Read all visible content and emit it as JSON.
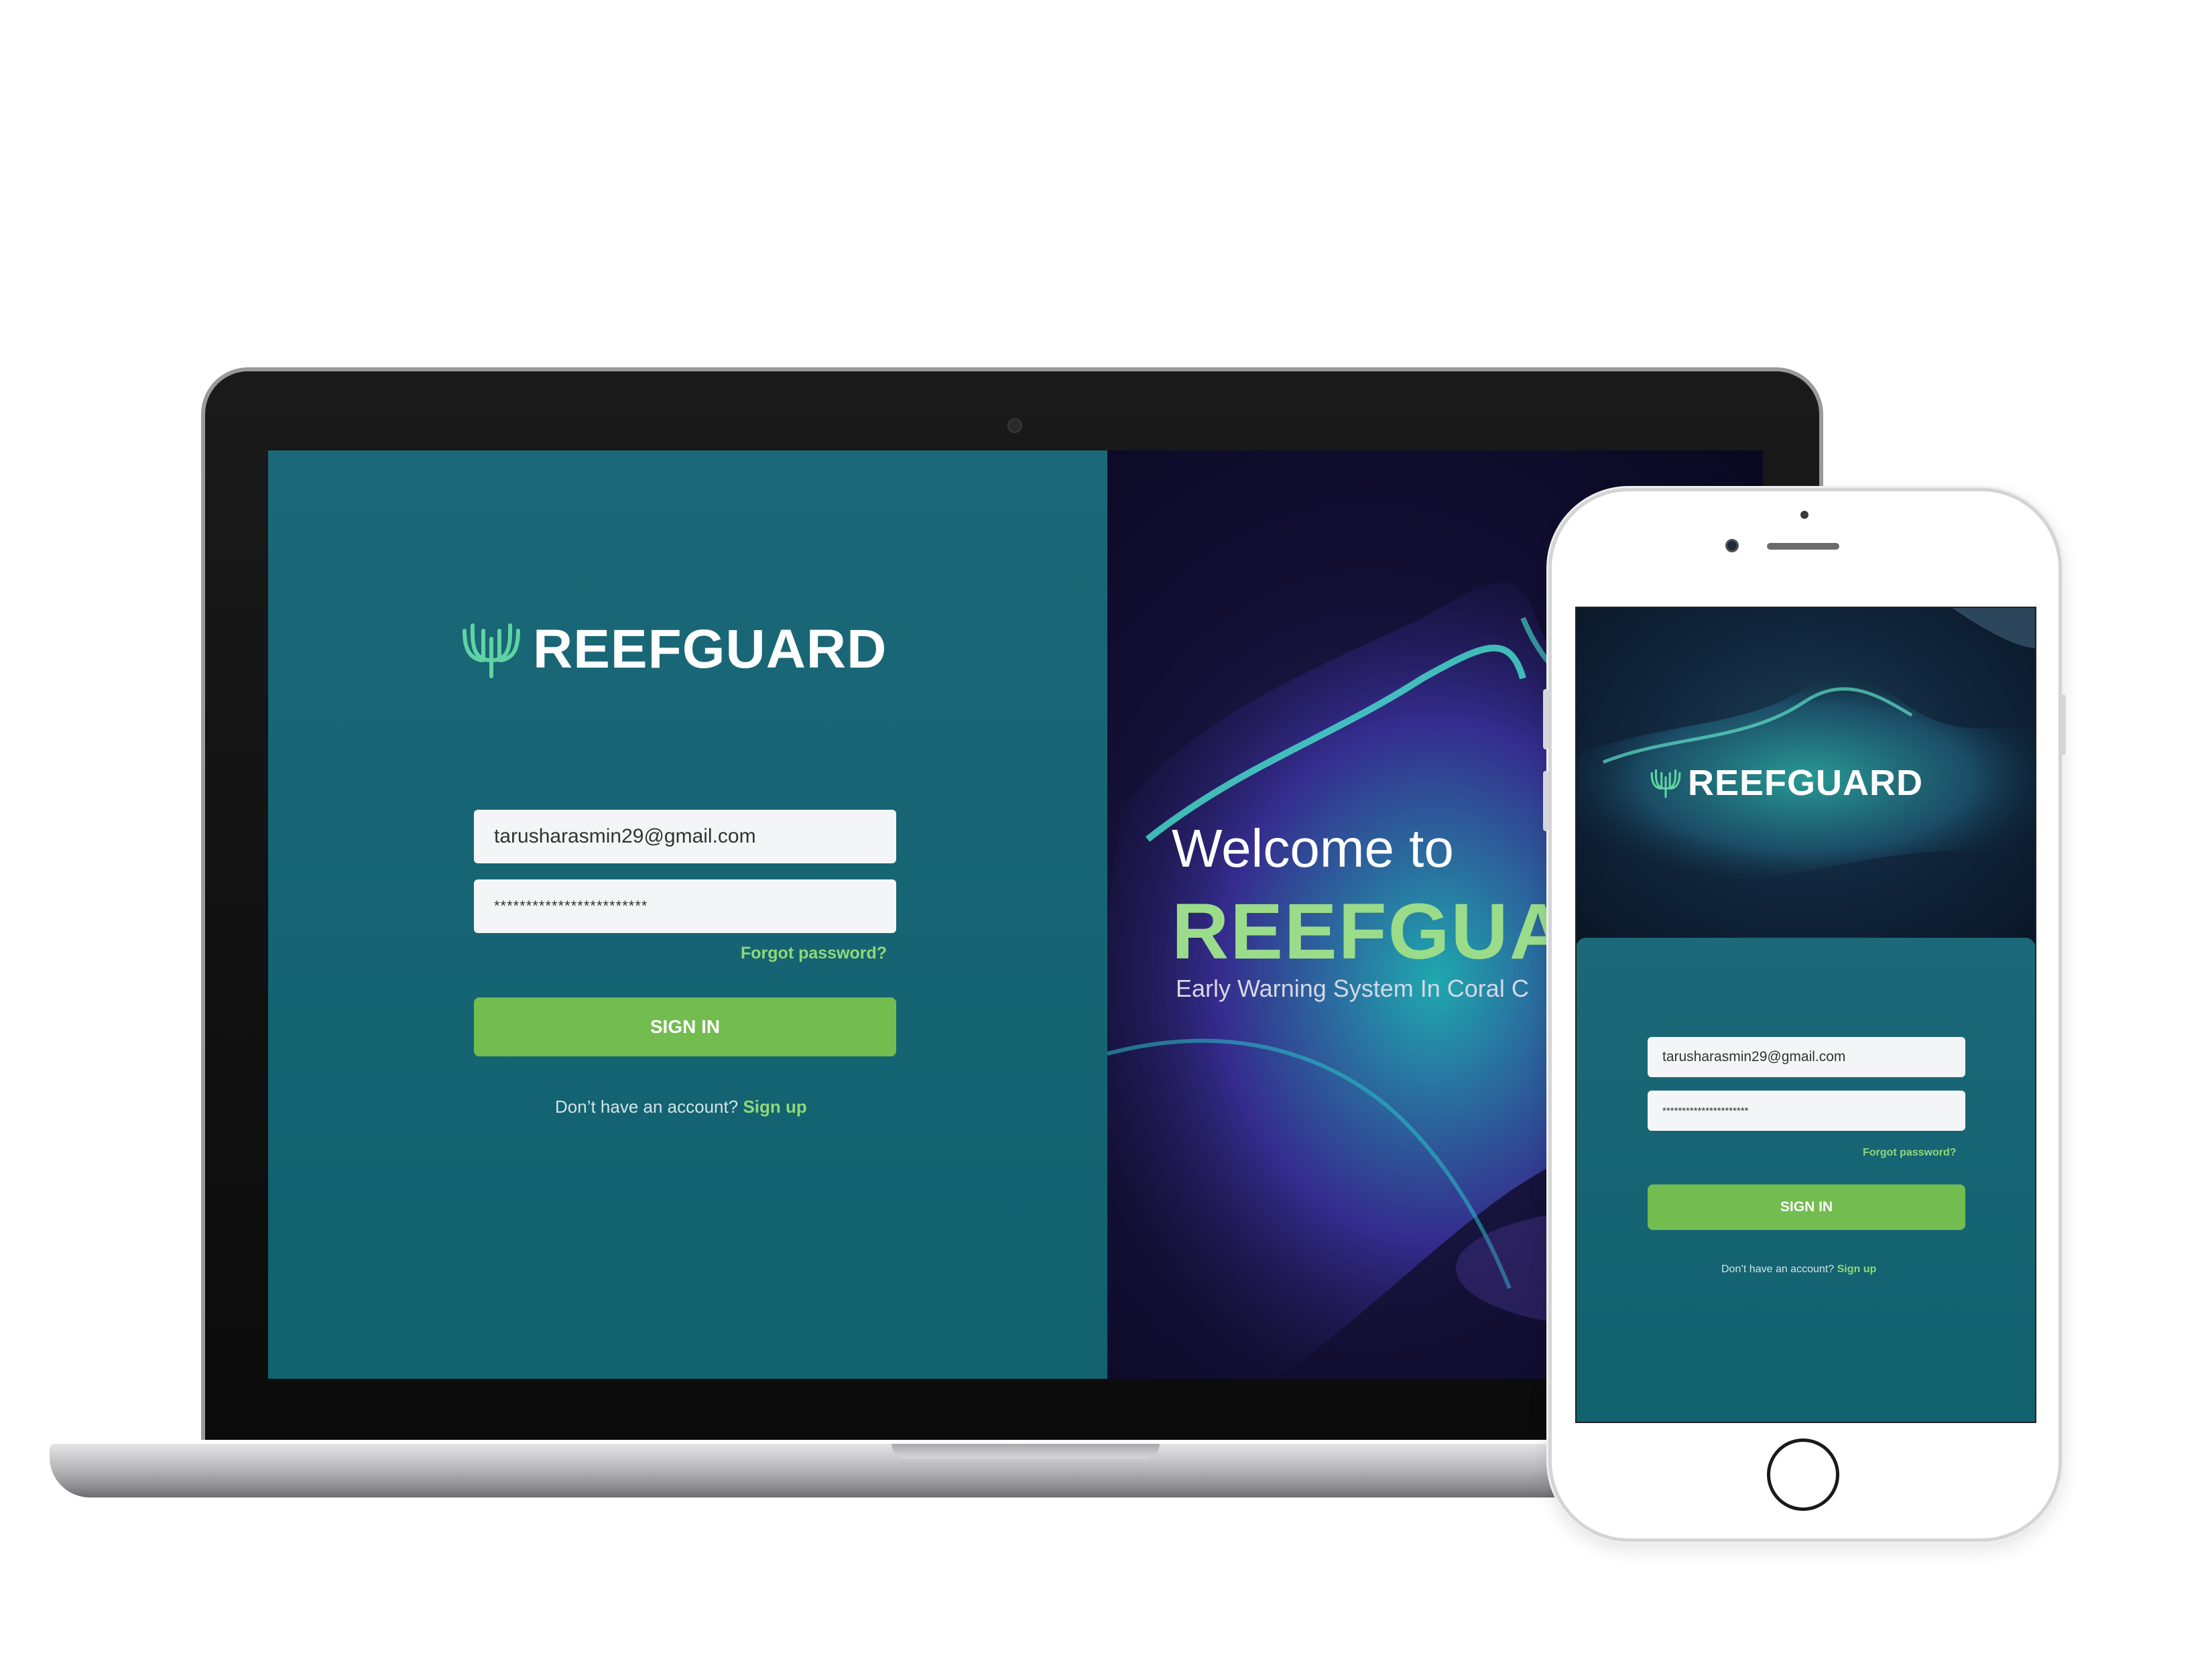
{
  "brand": {
    "name": "REEFGUARD",
    "logo_icon": "coral-logo-icon",
    "accent_color": "#5fd3a3"
  },
  "laptop": {
    "login": {
      "email_value": "tarusharasmin29@gmail.com",
      "password_value": "************************",
      "forgot_label": "Forgot password?",
      "signin_label": "SIGN IN",
      "signup_prompt": "Don’t have an account?",
      "signup_link": "Sign up"
    },
    "hero": {
      "welcome": "Welcome to",
      "title": "REEFGUA",
      "tagline": "Early Warning System In Coral C"
    }
  },
  "phone": {
    "login": {
      "email_value": "tarusharasmin29@gmail.com",
      "password_value": "**********************",
      "forgot_label": "Forgot password?",
      "signin_label": "SIGN IN",
      "signup_prompt": "Don’t have an account?",
      "signup_link": "Sign up"
    }
  },
  "colors": {
    "panel_teal": "#1b6878",
    "button_green": "#72bc50",
    "link_green": "#8fd978",
    "hero_title_green": "#9bdc8a"
  }
}
